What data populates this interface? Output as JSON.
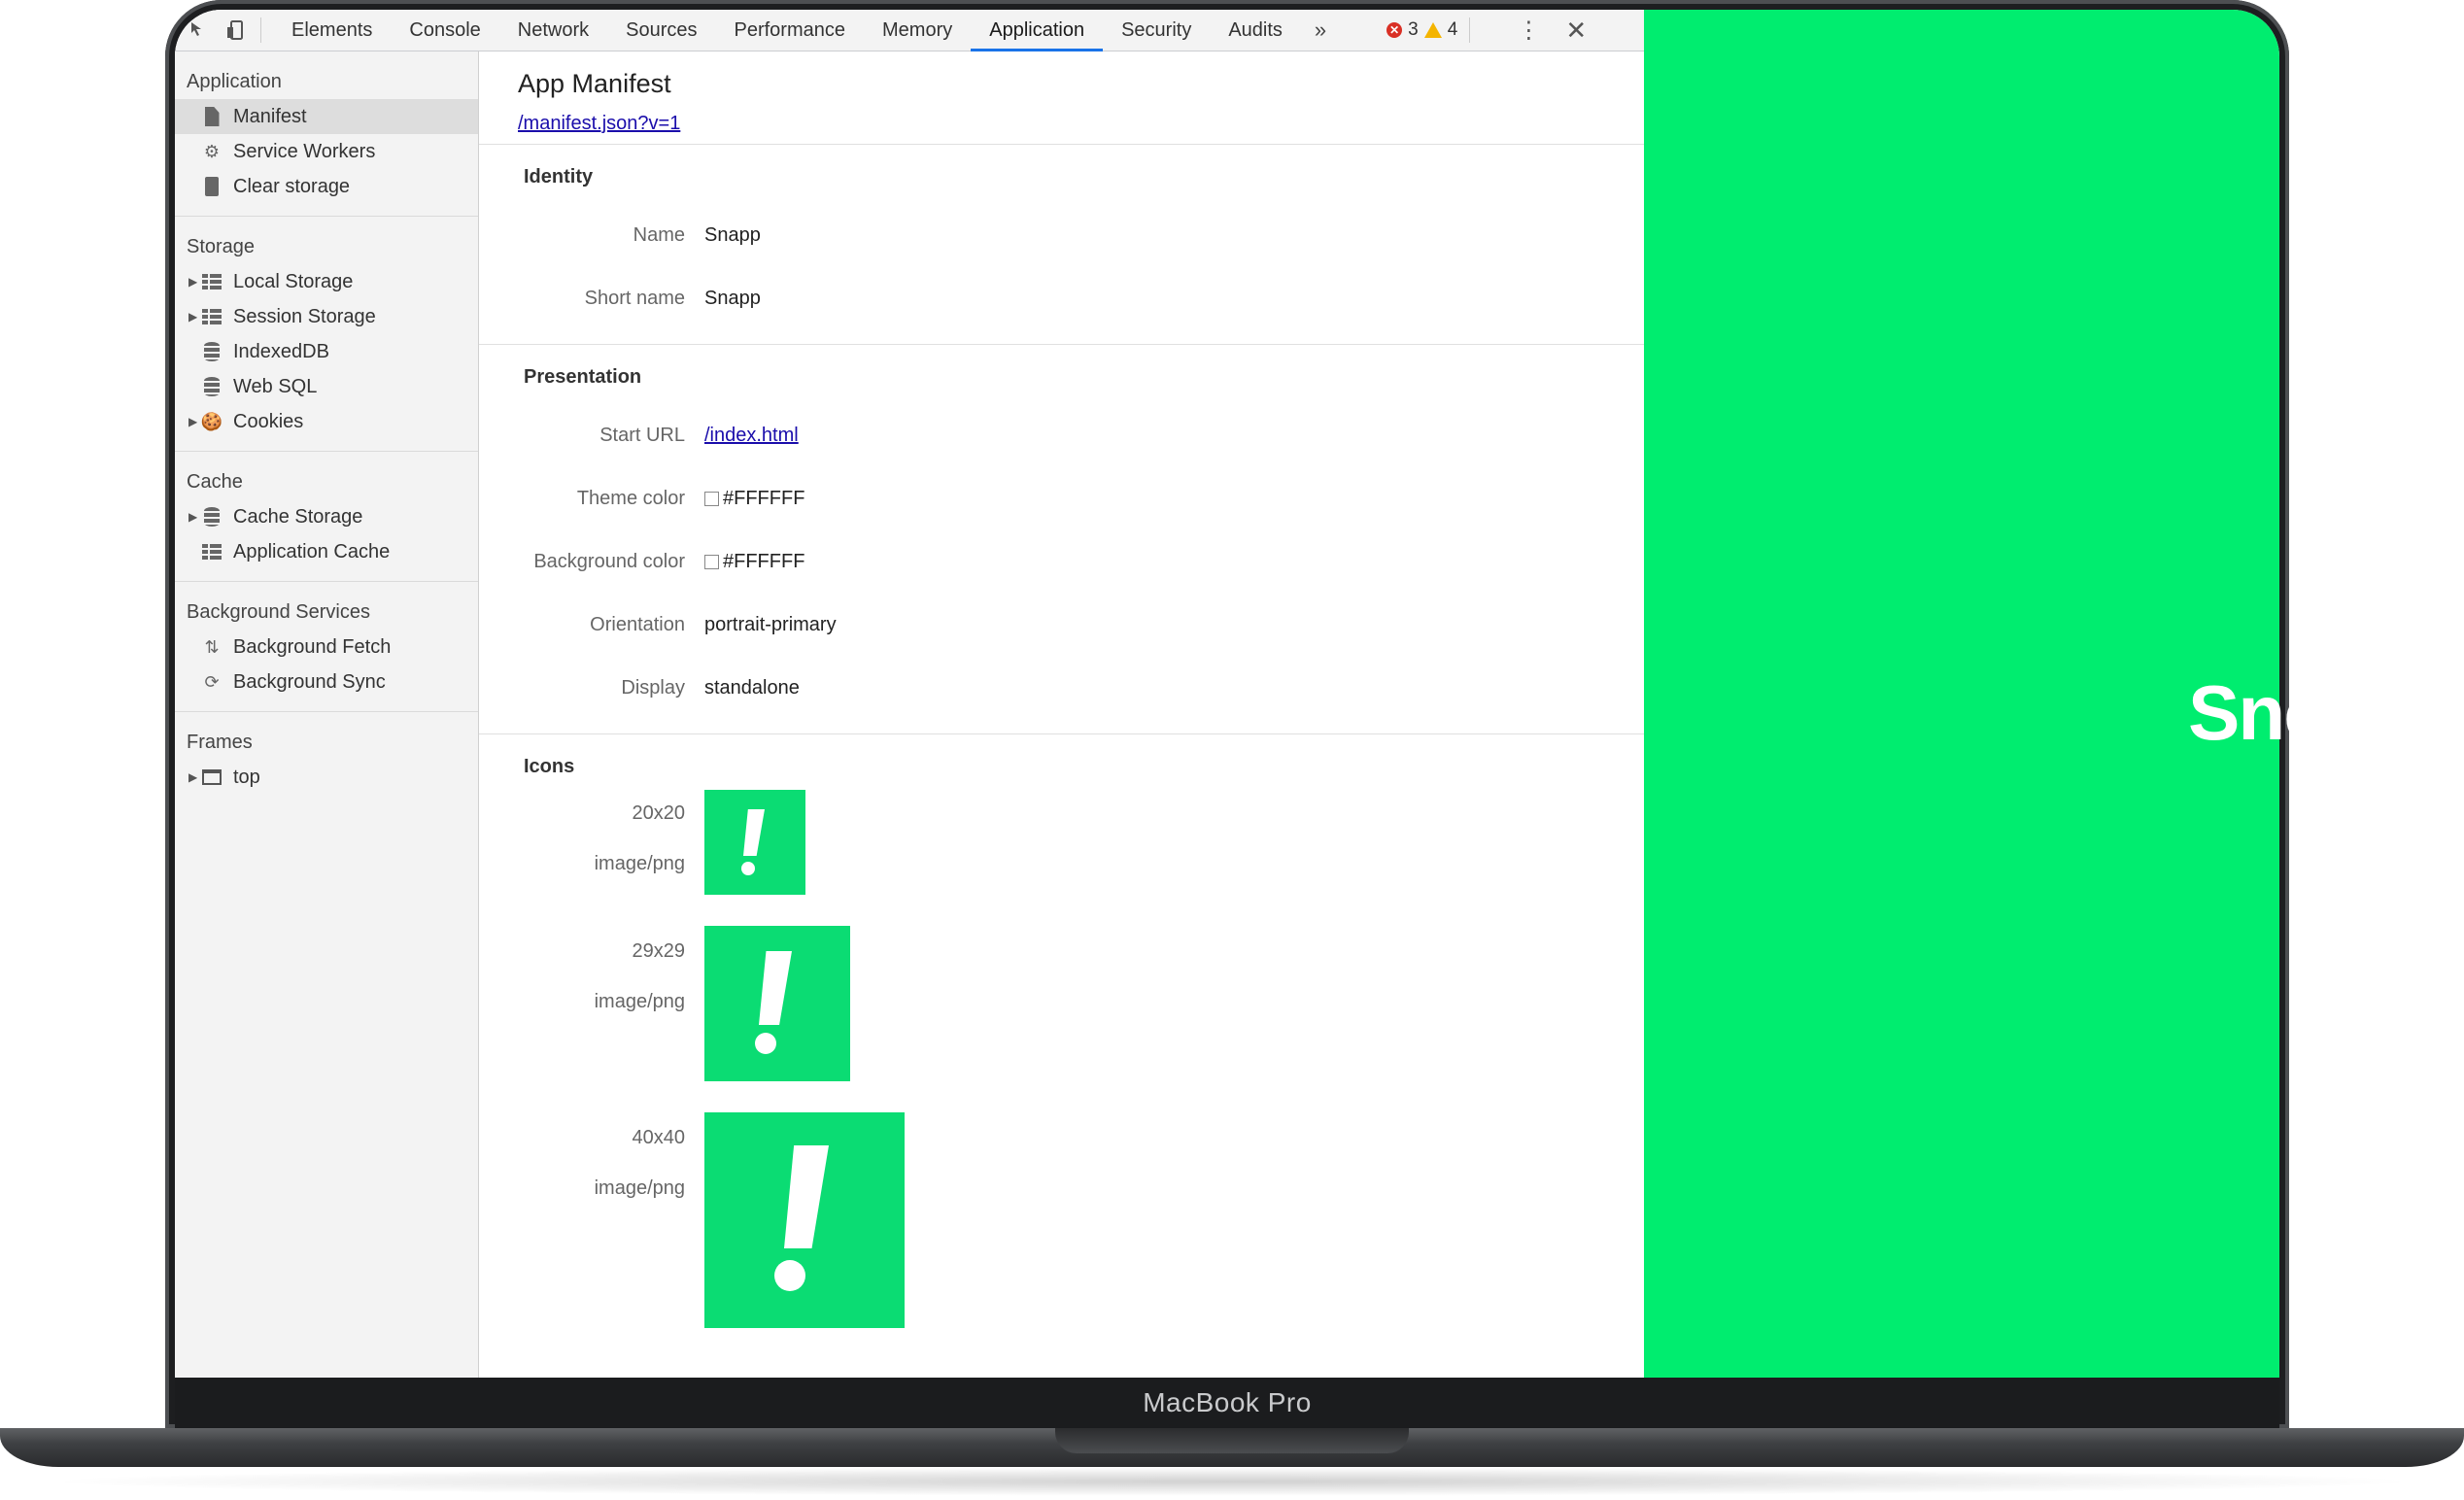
{
  "device": {
    "label": "MacBook Pro"
  },
  "toolbar": {
    "tabs": [
      "Elements",
      "Console",
      "Network",
      "Sources",
      "Performance",
      "Memory",
      "Application",
      "Security",
      "Audits"
    ],
    "active_tab": "Application",
    "more": "»",
    "errors": "3",
    "warnings": "4"
  },
  "sidebar": {
    "sections": [
      {
        "title": "Application",
        "items": [
          "Manifest",
          "Service Workers",
          "Clear storage"
        ]
      },
      {
        "title": "Storage",
        "items": [
          "Local Storage",
          "Session Storage",
          "IndexedDB",
          "Web SQL",
          "Cookies"
        ]
      },
      {
        "title": "Cache",
        "items": [
          "Cache Storage",
          "Application Cache"
        ]
      },
      {
        "title": "Background Services",
        "items": [
          "Background Fetch",
          "Background Sync"
        ]
      },
      {
        "title": "Frames",
        "items": [
          "top"
        ]
      }
    ],
    "selected": "Manifest"
  },
  "main": {
    "title": "App Manifest",
    "manifest_link": "/manifest.json?v=1",
    "identity": {
      "title": "Identity",
      "name_label": "Name",
      "name_value": "Snapp",
      "short_label": "Short name",
      "short_value": "Snapp"
    },
    "presentation": {
      "title": "Presentation",
      "start_label": "Start URL",
      "start_value": "/index.html",
      "theme_label": "Theme color",
      "theme_value": "#FFFFFF",
      "bg_label": "Background color",
      "bg_value": "#FFFFFF",
      "orientation_label": "Orientation",
      "orientation_value": "portrait-primary",
      "display_label": "Display",
      "display_value": "standalone"
    },
    "icons": {
      "title": "Icons",
      "items": [
        {
          "size": "20x20",
          "type": "image/png"
        },
        {
          "size": "29x29",
          "type": "image/png"
        },
        {
          "size": "40x40",
          "type": "image/png"
        }
      ],
      "icon_color": "#0bdc73"
    }
  },
  "app_preview": {
    "brand_partial": "Snc",
    "background": "#00ed6f"
  }
}
